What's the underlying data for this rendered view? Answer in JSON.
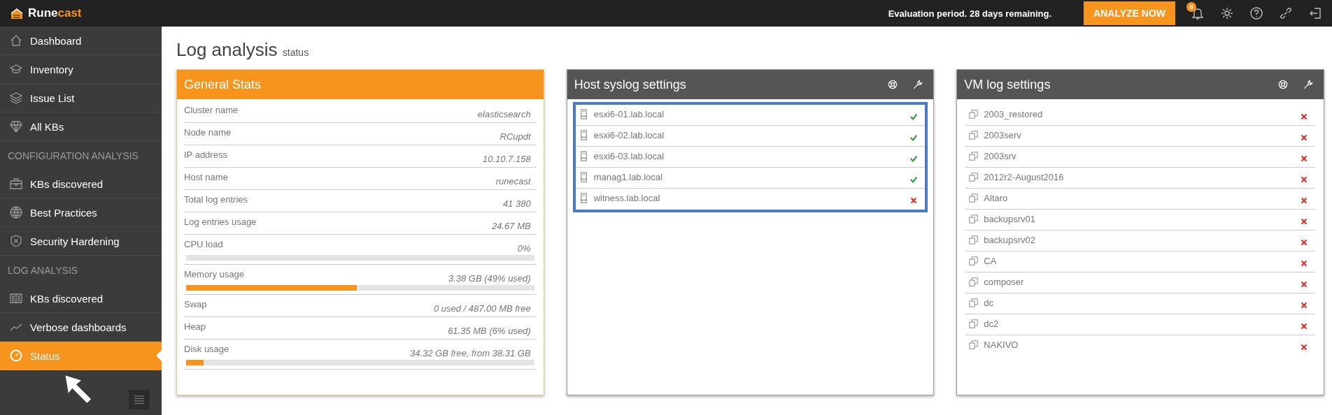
{
  "topbar": {
    "logo_parts": [
      "Rune",
      "cast"
    ],
    "notice": "Evaluation period. 28 days remaining.",
    "analyze_button": "ANALYZE NOW",
    "notification_count": "6"
  },
  "sidebar": {
    "items": [
      {
        "kind": "link",
        "label": "Dashboard",
        "selected": false
      },
      {
        "kind": "link",
        "label": "Inventory",
        "selected": false
      },
      {
        "kind": "link",
        "label": "Issue List",
        "selected": false
      },
      {
        "kind": "link",
        "label": "All KBs",
        "selected": false
      },
      {
        "kind": "section",
        "label": "CONFIGURATION ANALYSIS"
      },
      {
        "kind": "link",
        "label": "KBs discovered",
        "selected": false
      },
      {
        "kind": "link",
        "label": "Best Practices",
        "selected": false
      },
      {
        "kind": "link",
        "label": "Security Hardening",
        "selected": false
      },
      {
        "kind": "section",
        "label": "LOG ANALYSIS"
      },
      {
        "kind": "link",
        "label": "KBs discovered",
        "selected": false
      },
      {
        "kind": "link",
        "label": "Verbose dashboards",
        "selected": false
      },
      {
        "kind": "link",
        "label": "Status",
        "selected": true
      }
    ]
  },
  "page": {
    "title": "Log analysis",
    "subtitle": "status"
  },
  "general_stats": {
    "title": "General Stats",
    "rows": [
      {
        "label": "Cluster name",
        "value": "elasticsearch"
      },
      {
        "label": "Node name",
        "value": "RCupdt"
      },
      {
        "label": "IP address",
        "value": "10.10.7.158"
      },
      {
        "label": "Host name",
        "value": "runecast"
      },
      {
        "label": "Total log entries",
        "value": "41 380"
      },
      {
        "label": "Log entries usage",
        "value": "24.67 MB"
      },
      {
        "label": "CPU load",
        "value": "0%",
        "level": 0
      },
      {
        "label": "Memory usage",
        "value": "3.38 GB (49% used)",
        "level": 0.49
      },
      {
        "label": "Swap",
        "value": "0 used / 487.00 MB free"
      },
      {
        "label": "Heap",
        "value": "61.35 MB (6% used)"
      },
      {
        "label": "Disk usage",
        "value": "34.32 GB free, from 38.31 GB",
        "level": 0.05
      }
    ]
  },
  "host_syslog": {
    "title": "Host syslog settings",
    "highlighted": true,
    "rows": [
      {
        "name": "esxi6-01.lab.local",
        "ok": true
      },
      {
        "name": "esxi6-02.lab.local",
        "ok": true
      },
      {
        "name": "esxi6-03.lab.local",
        "ok": true
      },
      {
        "name": "manag1.lab.local",
        "ok": true
      },
      {
        "name": "witness.lab.local",
        "ok": false
      }
    ]
  },
  "vm_log": {
    "title": "VM log settings",
    "highlighted": false,
    "rows": [
      {
        "name": "2003_restored",
        "ok": false
      },
      {
        "name": "2003serv",
        "ok": false
      },
      {
        "name": "2003srv",
        "ok": false
      },
      {
        "name": "2012r2-August2016",
        "ok": false
      },
      {
        "name": "Altaro",
        "ok": false
      },
      {
        "name": "backupsrv01",
        "ok": false
      },
      {
        "name": "backupsrv02",
        "ok": false
      },
      {
        "name": "CA",
        "ok": false
      },
      {
        "name": "composer",
        "ok": false
      },
      {
        "name": "dc",
        "ok": false
      },
      {
        "name": "dc2",
        "ok": false
      },
      {
        "name": "NAKIVO",
        "ok": false
      }
    ]
  }
}
